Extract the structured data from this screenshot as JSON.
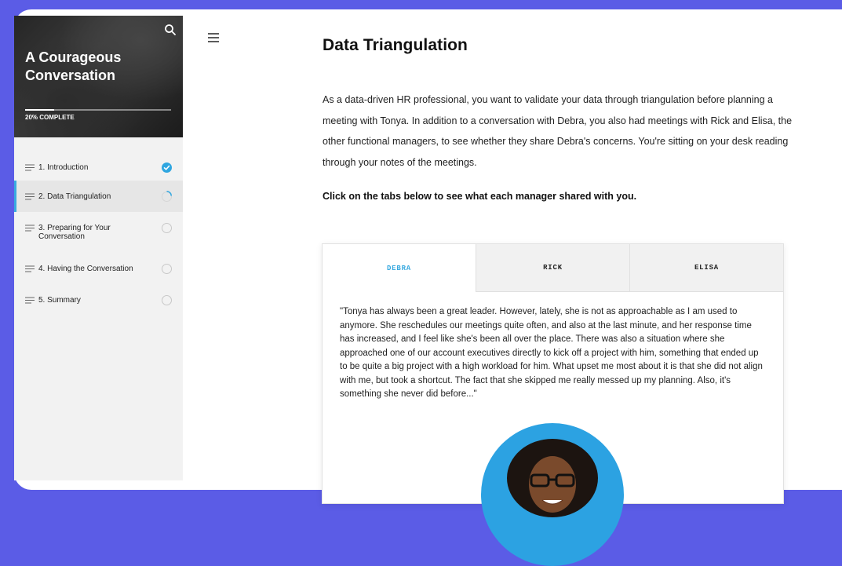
{
  "course": {
    "title": "A Courageous Conversation",
    "progress_label": "20% COMPLETE",
    "progress_fraction": 0.2
  },
  "nav": {
    "items": [
      {
        "label": "1. Introduction",
        "status": "complete"
      },
      {
        "label": "2. Data Triangulation",
        "status": "in-progress"
      },
      {
        "label": "3. Preparing for Your Conversation",
        "status": "not-started"
      },
      {
        "label": "4. Having the Conversation",
        "status": "not-started"
      },
      {
        "label": "5. Summary",
        "status": "not-started"
      }
    ]
  },
  "main": {
    "title": "Data Triangulation",
    "intro": "As a data-driven HR professional, you want to validate your data through triangulation before planning a meeting with Tonya. In addition to a conversation with Debra, you also had meetings with Rick and Elisa, the other functional managers, to see whether they share Debra's concerns. You're sitting on your desk reading through your notes of the meetings.",
    "instruction": "Click on the tabs below to see what each manager shared with you."
  },
  "tabs": {
    "items": [
      "DEBRA",
      "RICK",
      "ELISA"
    ],
    "active_index": 0,
    "quote": "\"Tonya has always been a great leader. However, lately, she is not as approachable as I am used to anymore. She reschedules our meetings quite often, and also at the last minute, and her response time has increased, and I feel like she's been all over the place. There was also a situation where she approached one of our account executives directly to kick off a project with him, something that ended up to be quite a big project with a high workload for him. What upset me most about it is that she did not align with me, but took a shortcut. The fact that she skipped me really messed up my planning. Also, it's something she never did before...\""
  },
  "colors": {
    "background": "#5b5ce6",
    "accent": "#38a9e0",
    "avatar_bg": "#2ca2e2"
  },
  "icons": {
    "search": "search-icon",
    "menu": "hamburger-menu-icon",
    "lesson": "lesson-lines-icon",
    "complete": "checkmark-circle-icon"
  }
}
